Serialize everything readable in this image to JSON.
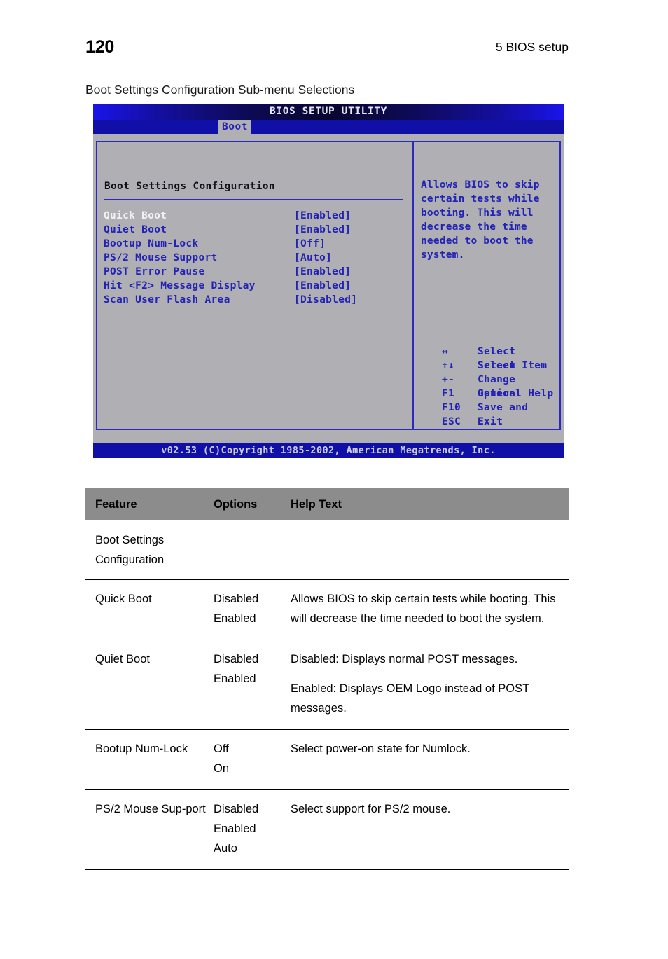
{
  "page": {
    "number": "120",
    "chapter": "5 BIOS setup",
    "caption": "Boot Settings Configuration Sub-menu Selections"
  },
  "bios": {
    "title": "BIOS SETUP UTILITY",
    "menu_tab": "Boot",
    "section_title": "Boot Settings Configuration",
    "rows": [
      {
        "label": "Quick Boot",
        "value": "[Enabled]",
        "selected": true
      },
      {
        "label": "Quiet Boot",
        "value": "[Enabled]",
        "selected": false
      },
      {
        "label": "Bootup Num-Lock",
        "value": "[Off]",
        "selected": false
      },
      {
        "label": "PS/2 Mouse Support",
        "value": "[Auto]",
        "selected": false
      },
      {
        "label": "POST Error Pause",
        "value": "[Enabled]",
        "selected": false
      },
      {
        "label": "Hit <F2> Message Display",
        "value": "[Enabled]",
        "selected": false
      },
      {
        "label": "Scan User Flash Area",
        "value": "[Disabled]",
        "selected": false
      }
    ],
    "help_text": "Allows BIOS to skip certain tests while booting. This will decrease the time needed to boot the system.",
    "keys": [
      {
        "key": "↔",
        "desc": "Select Screen"
      },
      {
        "key": "↑↓",
        "desc": "Select Item"
      },
      {
        "key": "+-",
        "desc": "Change Option"
      },
      {
        "key": "F1",
        "desc": "General Help"
      },
      {
        "key": "F10",
        "desc": "Save and Exit"
      },
      {
        "key": "ESC",
        "desc": "Exit"
      }
    ],
    "footer": "v02.53 (C)Copyright 1985-2002, American Megatrends, Inc.",
    "colors": {
      "panel_bg": "#b0b0b4",
      "border_blue": "#2a2ac0",
      "text_blue": "#2222b4",
      "bar_blue": "#1010a8",
      "selected_text": "#f2f2f2"
    }
  },
  "table": {
    "headers": {
      "feature": "Feature",
      "options": "Options",
      "help": "Help Text"
    },
    "header_bg": "#8c8c8c",
    "rows": [
      {
        "feature": "Boot Settings Configuration",
        "options": [],
        "help": []
      },
      {
        "feature": "Quick Boot",
        "options": [
          "Disabled",
          "Enabled"
        ],
        "help": [
          "Allows BIOS to skip certain tests while booting. This will decrease the time needed to boot the system."
        ]
      },
      {
        "feature": "Quiet Boot",
        "options": [
          "Disabled",
          "Enabled"
        ],
        "help": [
          "Disabled: Displays normal POST messages.",
          "Enabled: Displays OEM Logo instead of POST messages."
        ]
      },
      {
        "feature": "Bootup Num-Lock",
        "options": [
          "Off",
          "On"
        ],
        "help": [
          "Select power-on state for Numlock."
        ]
      },
      {
        "feature": "PS/2 Mouse Sup-port",
        "options": [
          "Disabled",
          "Enabled",
          "Auto"
        ],
        "help": [
          "Select support for PS/2 mouse."
        ]
      }
    ]
  }
}
